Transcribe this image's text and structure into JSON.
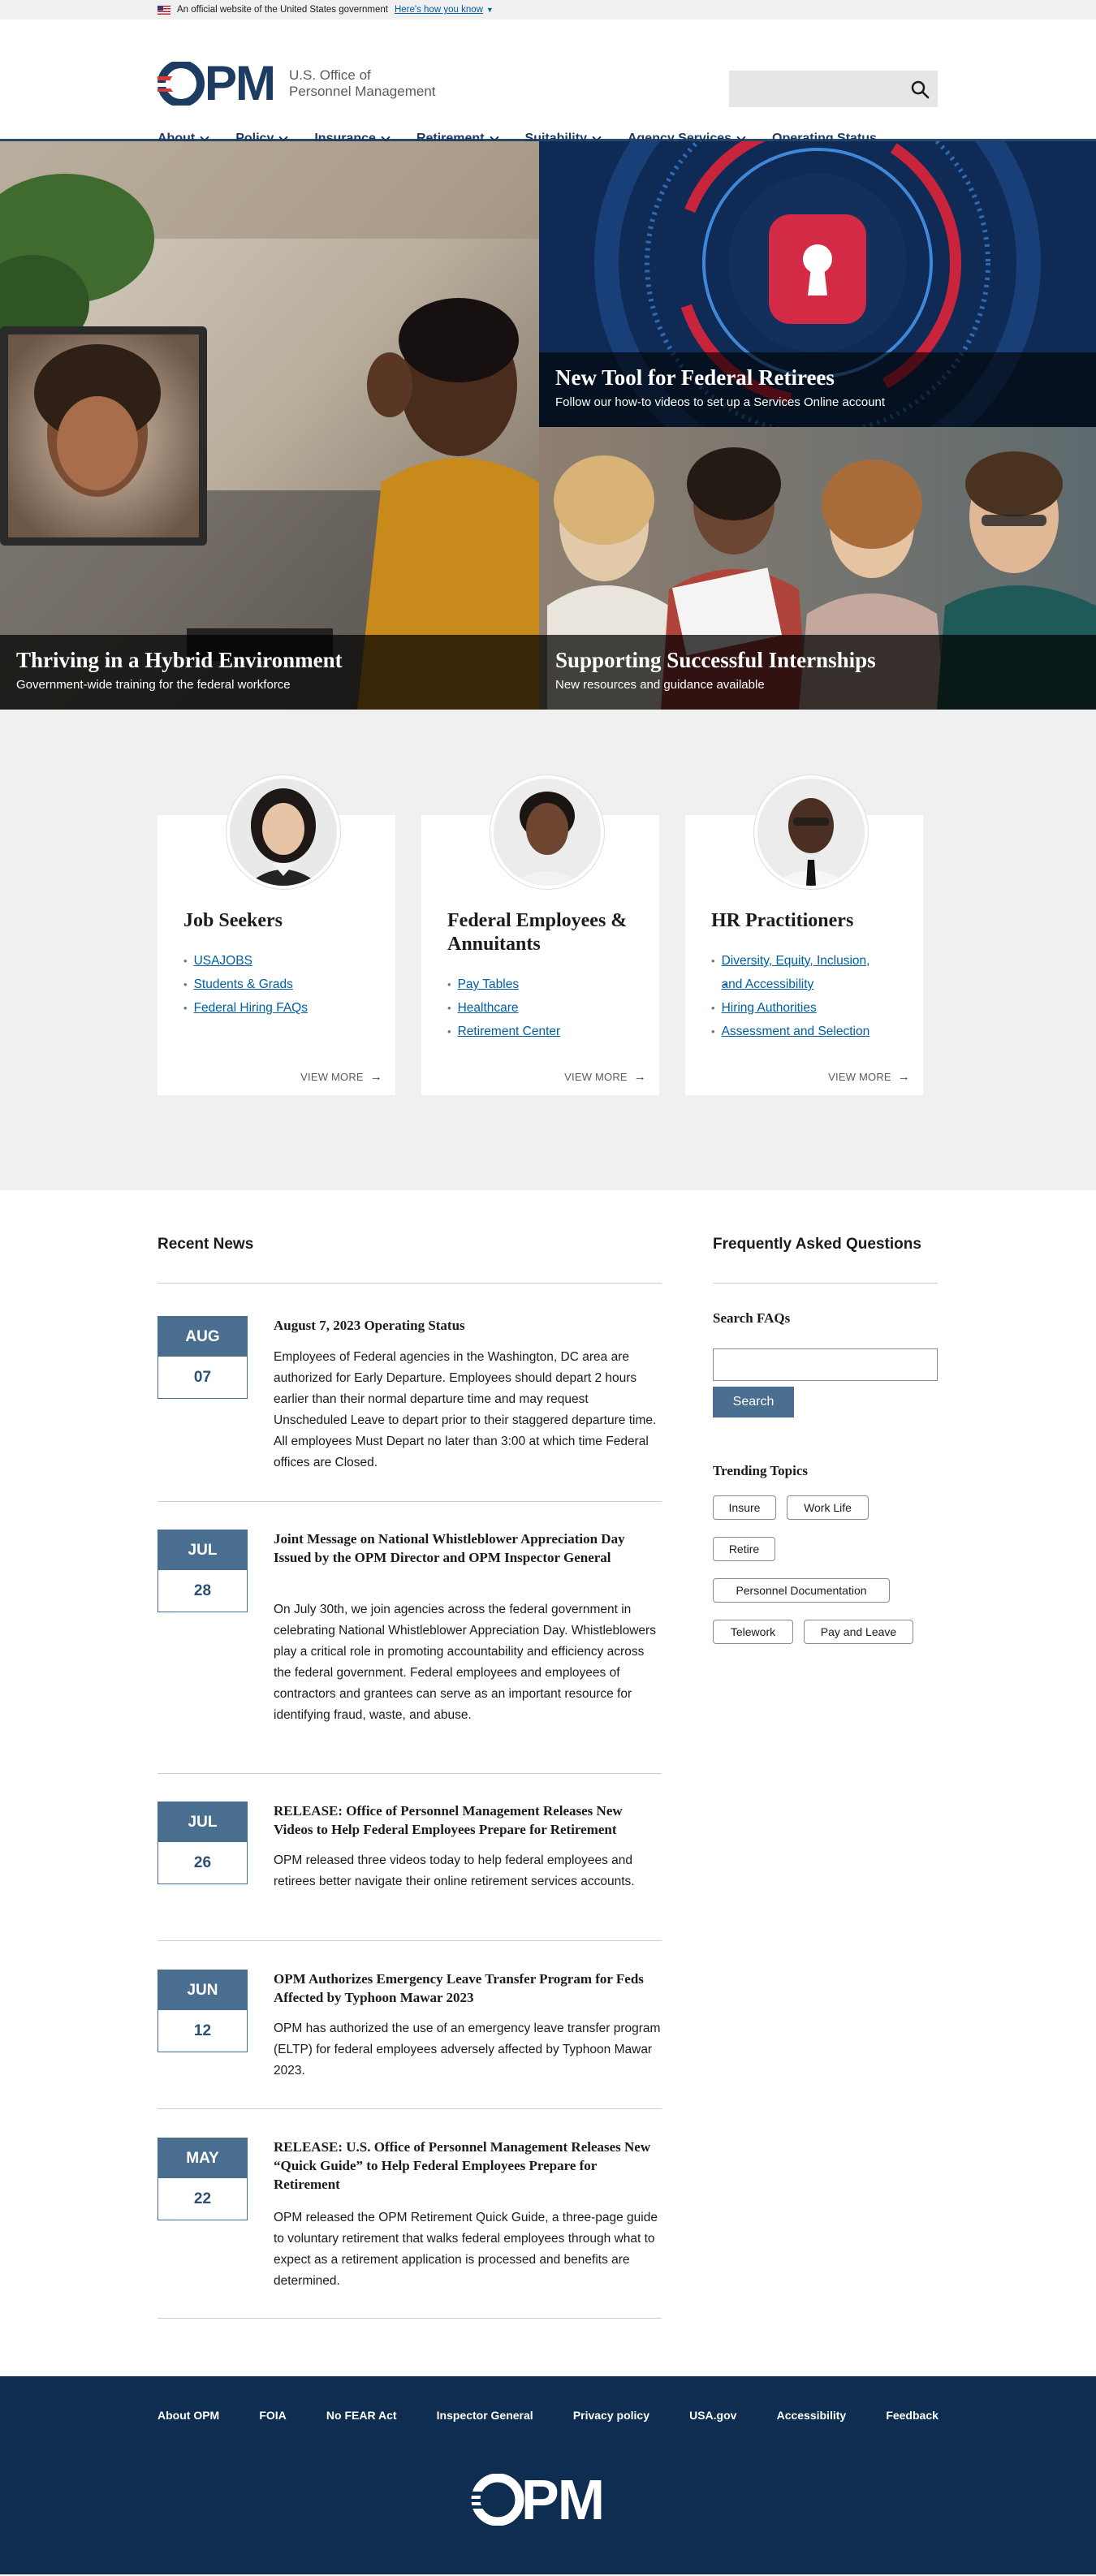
{
  "gov_banner": {
    "text": "An official website of the United States government",
    "link": "Here's how you know"
  },
  "header": {
    "logo_text": "OPM",
    "org_line1": "U.S. Office of",
    "org_line2": "Personnel Management",
    "nav": [
      {
        "label": "About",
        "has_dropdown": true
      },
      {
        "label": "Policy",
        "has_dropdown": true
      },
      {
        "label": "Insurance",
        "has_dropdown": true
      },
      {
        "label": "Retirement",
        "has_dropdown": true
      },
      {
        "label": "Suitability",
        "has_dropdown": true
      },
      {
        "label": "Agency Services",
        "has_dropdown": true
      },
      {
        "label": "Operating Status",
        "has_dropdown": false
      }
    ]
  },
  "hero": {
    "tiles": [
      {
        "title": "Thriving in a Hybrid Environment",
        "subtitle": "Government-wide training for the federal workforce"
      },
      {
        "title": "New Tool for Federal Retirees",
        "subtitle": "Follow our how-to videos to set up a Services Online account"
      },
      {
        "title": "Supporting Successful Internships",
        "subtitle": "New resources and guidance available"
      }
    ]
  },
  "audiences": [
    {
      "title": "Job Seekers",
      "links": [
        "USAJOBS",
        "Students & Grads",
        "Federal Hiring FAQs"
      ],
      "view_more": "VIEW MORE"
    },
    {
      "title": "Federal Employees & Annuitants",
      "links": [
        "Pay Tables",
        "Healthcare",
        "Retirement Center"
      ],
      "view_more": "VIEW MORE"
    },
    {
      "title": "HR Practitioners",
      "links": [
        "Diversity, Equity, Inclusion,",
        "and Accessibility",
        "Hiring Authorities",
        "Assessment and Selection"
      ],
      "view_more": "VIEW MORE"
    }
  ],
  "news": {
    "heading": "Recent News",
    "items": [
      {
        "month": "AUG",
        "day": "07",
        "title": "August 7, 2023 Operating Status",
        "body": "Employees of Federal agencies in the Washington, DC area are authorized for Early Departure. Employees should depart 2 hours earlier than their normal departure time and may request Unscheduled Leave to depart prior to their staggered departure time. All employees Must Depart no later than 3:00 at which time Federal offices are Closed."
      },
      {
        "month": "JUL",
        "day": "28",
        "title": "Joint Message on National Whistleblower Appreciation Day Issued by the OPM Director and OPM Inspector General",
        "body": "On July 30th, we join agencies across the federal government in celebrating National Whistleblower Appreciation Day. Whistleblowers play a critical role in promoting accountability and efficiency across the federal government. Federal employees and employees of contractors and grantees can serve as an important resource for identifying fraud, waste, and abuse."
      },
      {
        "month": "JUL",
        "day": "26",
        "title": "RELEASE: Office of Personnel Management Releases New Videos to Help Federal Employees Prepare for Retirement",
        "body": "OPM released three videos today to help federal employees and retirees better navigate their online retirement services accounts."
      },
      {
        "month": "JUN",
        "day": "12",
        "title": "OPM Authorizes Emergency Leave Transfer Program for Feds Affected by Typhoon Mawar 2023",
        "body": "OPM has authorized the use of an emergency leave transfer program (ELTP) for federal employees adversely affected by Typhoon Mawar 2023."
      },
      {
        "month": "MAY",
        "day": "22",
        "title": "RELEASE: U.S. Office of Personnel Management Releases New “Quick Guide” to Help Federal Employees Prepare for Retirement",
        "body": "OPM released the OPM Retirement Quick Guide, a three-page guide to voluntary retirement that walks federal employees through what to expect as a retirement application is processed and benefits are determined."
      }
    ]
  },
  "faq": {
    "heading": "Frequently Asked Questions",
    "search_label": "Search FAQs",
    "search_value": "",
    "search_button": "Search",
    "trending_label": "Trending Topics",
    "tags": [
      "Insure",
      "Work Life",
      "Retire",
      "Personnel Documentation",
      "Telework",
      "Pay and Leave"
    ]
  },
  "footer": {
    "links": [
      "About OPM",
      "FOIA",
      "No FEAR Act",
      "Inspector General",
      "Privacy policy",
      "USA.gov",
      "Accessibility",
      "Feedback"
    ],
    "logo_text": "OPM"
  },
  "colors": {
    "navy": "#1e3c62",
    "slate_blue": "#4a6e8f",
    "link_blue": "#005ea2",
    "footer_bg": "#0e2d50",
    "brand_red": "#d83933"
  }
}
